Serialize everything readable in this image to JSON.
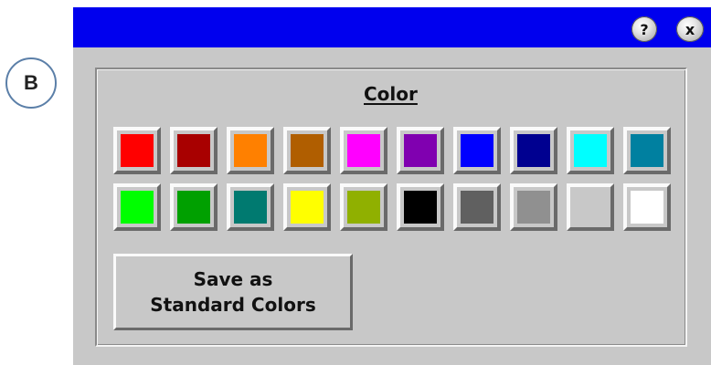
{
  "callout": {
    "label": "B"
  },
  "titlebar": {
    "help_glyph": "?",
    "close_glyph": "x",
    "color": "#0000ee"
  },
  "section": {
    "label": "Color"
  },
  "swatches": [
    {
      "color": "#ff0000"
    },
    {
      "color": "#a80000"
    },
    {
      "color": "#ff8000"
    },
    {
      "color": "#b05e00"
    },
    {
      "color": "#ff00ff"
    },
    {
      "color": "#8000b0"
    },
    {
      "color": "#0000ff"
    },
    {
      "color": "#000090"
    },
    {
      "color": "#00ffff"
    },
    {
      "color": "#0080a0"
    },
    {
      "color": "#00ff00"
    },
    {
      "color": "#00a000"
    },
    {
      "color": "#007a70"
    },
    {
      "color": "#ffff00"
    },
    {
      "color": "#90b000"
    },
    {
      "color": "#000000"
    },
    {
      "color": "#606060"
    },
    {
      "color": "#909090"
    },
    {
      "color": "#c8c8c8"
    },
    {
      "color": "#ffffff"
    }
  ],
  "save_button": {
    "line1": "Save as",
    "line2": "Standard Colors"
  }
}
